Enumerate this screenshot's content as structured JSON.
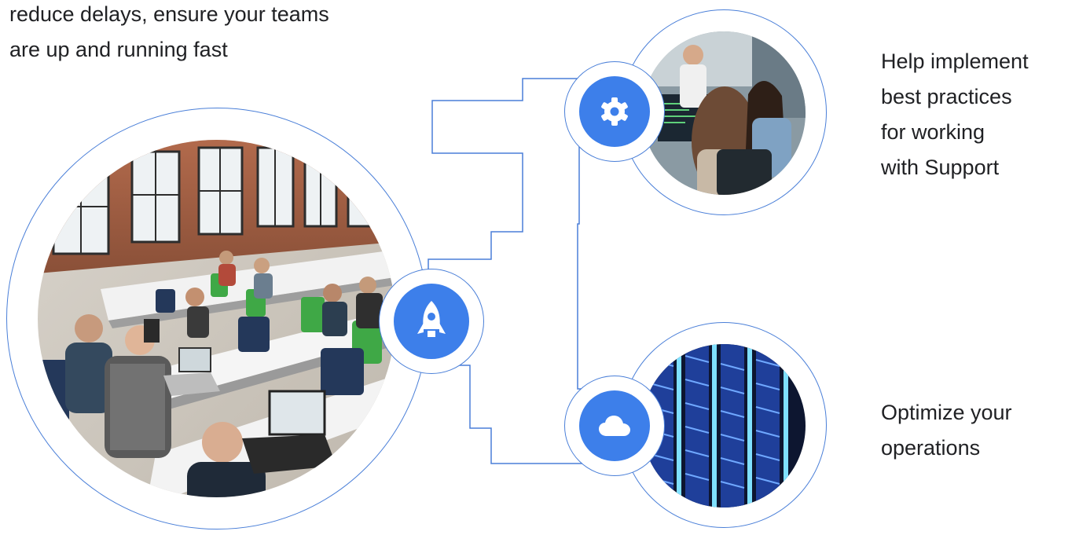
{
  "intro": {
    "lines": [
      "reduce delays, ensure your teams",
      "are up and running fast"
    ]
  },
  "features": [
    {
      "lines": [
        "Help implement",
        "best practices",
        "for working",
        "with Support"
      ],
      "icon": "gear-icon"
    },
    {
      "lines": [
        "Optimize your",
        "operations"
      ],
      "icon": "cloud-icon"
    }
  ],
  "main_icon": "rocket-icon",
  "colors": {
    "accent": "#3d7fea",
    "ring": "#4a7fd8",
    "text": "#202124"
  }
}
